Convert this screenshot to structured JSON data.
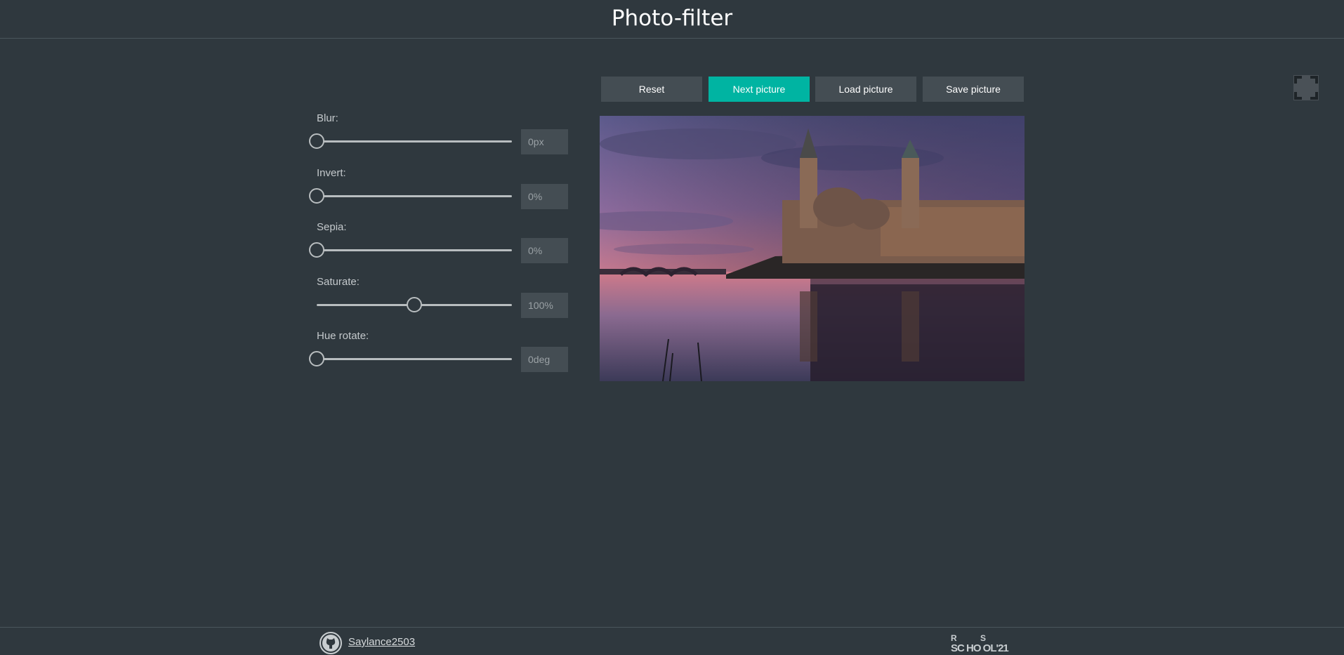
{
  "header": {
    "title": "Photo-filter"
  },
  "fullscreen": {
    "icon": "fullscreen-icon"
  },
  "filters": [
    {
      "label": "Blur:",
      "output": "0px",
      "value": 0,
      "max": 10
    },
    {
      "label": "Invert:",
      "output": "0%",
      "value": 0,
      "max": 100
    },
    {
      "label": "Sepia:",
      "output": "0%",
      "value": 0,
      "max": 100
    },
    {
      "label": "Saturate:",
      "output": "100%",
      "value": 100,
      "max": 200
    },
    {
      "label": "Hue rotate:",
      "output": "0deg",
      "value": 0,
      "max": 360
    }
  ],
  "toolbar": {
    "buttons": [
      {
        "label": "Reset",
        "active": false
      },
      {
        "label": "Next picture",
        "active": true
      },
      {
        "label": "Load picture",
        "active": false
      },
      {
        "label": "Save picture",
        "active": false
      }
    ]
  },
  "footer": {
    "github_user": "Saylance2503",
    "github_icon": "github-icon",
    "logo_text": "RS SCHOOL '21"
  },
  "colors": {
    "background": "#2f383e",
    "accent": "#00b4a2",
    "button": "#444d53"
  }
}
